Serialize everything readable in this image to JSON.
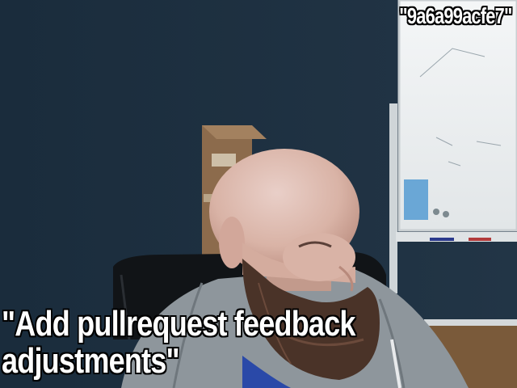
{
  "overlay": {
    "hash_text": "\"9a6a99acfe7\"",
    "message_line1": "\"Add pullrequest feedback",
    "message_line2": "adjustments\""
  }
}
